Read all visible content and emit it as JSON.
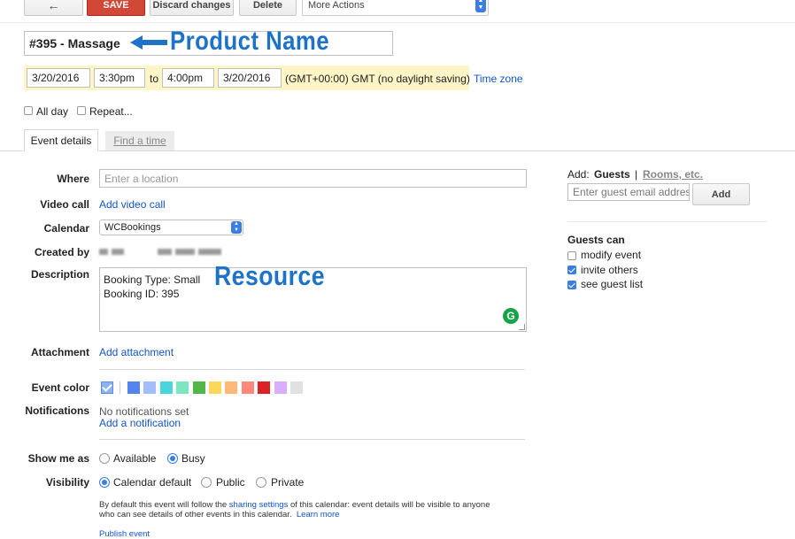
{
  "toolbar": {
    "back_label": "←",
    "save_label": "SAVE",
    "discard_label": "Discard changes",
    "delete_label": "Delete",
    "more_actions_label": "More Actions"
  },
  "event": {
    "title": "#395 - Massage",
    "start_date": "3/20/2016",
    "start_time": "3:30pm",
    "to_label": "to",
    "end_time": "4:00pm",
    "end_date": "3/20/2016",
    "timezone_text": "(GMT+00:00) GMT (no daylight saving)",
    "timezone_link": "Time zone",
    "all_day_label": "All day",
    "repeat_label": "Repeat..."
  },
  "annotations": {
    "product_name": "Product Name",
    "resource": "Resource"
  },
  "tabs": [
    {
      "label": "Event details",
      "active": true
    },
    {
      "label": "Find a time",
      "active": false
    }
  ],
  "details": {
    "where_label": "Where",
    "where_placeholder": "Enter a location",
    "video_label": "Video call",
    "video_link": "Add video call",
    "calendar_label": "Calendar",
    "calendar_value": "WCBookings",
    "created_label": "Created by",
    "description_label": "Description",
    "description_line1": "Booking Type: Small",
    "description_line2": "Booking ID: 395",
    "attachment_label": "Attachment",
    "attachment_link": "Add attachment",
    "color_label": "Event color",
    "notifications_label": "Notifications",
    "notifications_value": "No notifications set",
    "notifications_link": "Add a notification",
    "showme_label": "Show me as",
    "available_label": "Available",
    "busy_label": "Busy",
    "visibility_label": "Visibility",
    "vis_default": "Calendar default",
    "vis_public": "Public",
    "vis_private": "Private",
    "vis_note_a": "By default this event will follow the ",
    "vis_note_link": "sharing settings",
    "vis_note_b": " of this calendar: event details will be visible to anyone",
    "vis_note_c": "who can see details of other events in this calendar.",
    "learn_more": "Learn more",
    "publish_link": "Publish event"
  },
  "event_colors": [
    "#5484ed",
    "#a4bdfc",
    "#46d6db",
    "#7ae7bf",
    "#51b749",
    "#fbd75b",
    "#ffb878",
    "#ff887c",
    "#dc2127",
    "#dbadff",
    "#e1e1e1"
  ],
  "guests": {
    "add_label": "Add:",
    "guests_tab": "Guests",
    "separator": "|",
    "rooms_tab": "Rooms, etc.",
    "email_placeholder": "Enter guest email addres",
    "add_button": "Add",
    "guests_can_label": "Guests can",
    "perm_modify": "modify event",
    "perm_invite": "invite others",
    "perm_see": "see guest list"
  }
}
